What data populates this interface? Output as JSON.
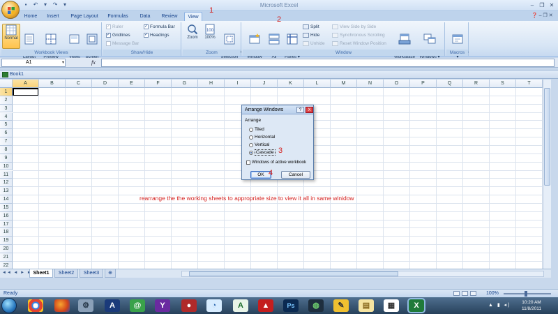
{
  "app": {
    "title": "Microsoft Excel"
  },
  "ribbon_tabs": [
    {
      "label": "Home"
    },
    {
      "label": "Insert"
    },
    {
      "label": "Page Layout"
    },
    {
      "label": "Formulas"
    },
    {
      "label": "Data"
    },
    {
      "label": "Review"
    },
    {
      "label": "View",
      "active": true
    }
  ],
  "groups": {
    "workbook_views": {
      "label": "Workbook Views",
      "buttons": [
        {
          "label": "Normal"
        },
        {
          "label": "Page\nLayout"
        },
        {
          "label": "Page Break\nPreview"
        },
        {
          "label": "Custom\nViews"
        },
        {
          "label": "Full\nScreen"
        }
      ]
    },
    "show_hide": {
      "label": "Show/Hide",
      "items": [
        {
          "label": "Ruler",
          "checked": true,
          "enabled": false
        },
        {
          "label": "Gridlines",
          "checked": true,
          "enabled": true
        },
        {
          "label": "Message Bar",
          "checked": false,
          "enabled": false
        },
        {
          "label": "Formula Bar",
          "checked": true,
          "enabled": true
        },
        {
          "label": "Headings",
          "checked": true,
          "enabled": true
        }
      ]
    },
    "zoom": {
      "label": "Zoom",
      "buttons": [
        {
          "label": "Zoom"
        },
        {
          "label": "100%"
        },
        {
          "label": "Zoom to\nSelection"
        }
      ]
    },
    "window": {
      "label": "Window",
      "big_buttons": [
        {
          "label": "New\nWindow"
        },
        {
          "label": "Arrange\nAll"
        },
        {
          "label": "Freeze\nPanes ▾"
        }
      ],
      "small": [
        {
          "label": "Split",
          "enabled": true
        },
        {
          "label": "Hide",
          "enabled": true
        },
        {
          "label": "Unhide",
          "enabled": false
        },
        {
          "label": "View Side by Side",
          "enabled": false
        },
        {
          "label": "Synchronous Scrolling",
          "enabled": false
        },
        {
          "label": "Reset Window Position",
          "enabled": false
        }
      ],
      "save_workspace": "Save\nWorkspace",
      "switch_windows": "Switch\nWindows ▾"
    },
    "macros": {
      "label": "Macros",
      "button": "Macros\n▾"
    }
  },
  "formula_bar": {
    "name_box": "A1",
    "fx": "fx",
    "value": ""
  },
  "workbook": {
    "title": "Book1",
    "columns": [
      "A",
      "B",
      "C",
      "D",
      "E",
      "F",
      "G",
      "H",
      "I",
      "J",
      "K",
      "L",
      "M",
      "N",
      "O",
      "P",
      "Q",
      "R",
      "S",
      "T"
    ],
    "rows": [
      "1",
      "2",
      "3",
      "4",
      "5",
      "6",
      "7",
      "8",
      "9",
      "10",
      "11",
      "12",
      "13",
      "14",
      "15",
      "16",
      "17",
      "18",
      "19",
      "20",
      "21",
      "22"
    ],
    "active_cell": "A1"
  },
  "sheets": [
    {
      "label": "Sheet1",
      "active": true
    },
    {
      "label": "Sheet2"
    },
    {
      "label": "Sheet3"
    }
  ],
  "status": {
    "ready": "Ready",
    "zoom": "100%"
  },
  "dialog": {
    "title": "Arrange Windows",
    "help": "?",
    "close": "X",
    "section": "Arrange",
    "options": [
      {
        "label": "Tiled",
        "selected": false
      },
      {
        "label": "Horizontal",
        "selected": false
      },
      {
        "label": "Vertical",
        "selected": false
      },
      {
        "label": "Cascade",
        "selected": true
      }
    ],
    "checkbox": "Windows of active workbook",
    "ok": "OK",
    "cancel": "Cancel"
  },
  "annotations": {
    "step1": "1",
    "step2": "2",
    "step3": "3",
    "step4": "4",
    "note": "rearrange the the working sheets to appropriate size to view it all in same winidow",
    "color": "#d4211f"
  },
  "taskbar": {
    "clock_time": "10:20 AM",
    "clock_date": "11/8/2011",
    "icons": [
      "browser-chrome",
      "browser-firefox",
      "settings",
      "font-app",
      "green-app",
      "messenger",
      "media",
      "chat",
      "app-a",
      "pdf",
      "photoshop",
      "paint",
      "draw",
      "folder",
      "document",
      "excel"
    ]
  }
}
